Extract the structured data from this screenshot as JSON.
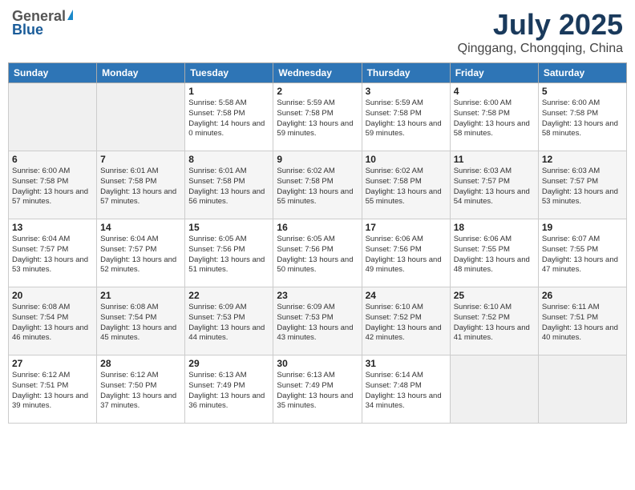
{
  "header": {
    "logo_general": "General",
    "logo_blue": "Blue",
    "title": "July 2025",
    "subtitle": "Qinggang, Chongqing, China"
  },
  "weekdays": [
    "Sunday",
    "Monday",
    "Tuesday",
    "Wednesday",
    "Thursday",
    "Friday",
    "Saturday"
  ],
  "weeks": [
    [
      {
        "day": "",
        "empty": true
      },
      {
        "day": "",
        "empty": true
      },
      {
        "day": "1",
        "sunrise": "Sunrise: 5:58 AM",
        "sunset": "Sunset: 7:58 PM",
        "daylight": "Daylight: 14 hours and 0 minutes."
      },
      {
        "day": "2",
        "sunrise": "Sunrise: 5:59 AM",
        "sunset": "Sunset: 7:58 PM",
        "daylight": "Daylight: 13 hours and 59 minutes."
      },
      {
        "day": "3",
        "sunrise": "Sunrise: 5:59 AM",
        "sunset": "Sunset: 7:58 PM",
        "daylight": "Daylight: 13 hours and 59 minutes."
      },
      {
        "day": "4",
        "sunrise": "Sunrise: 6:00 AM",
        "sunset": "Sunset: 7:58 PM",
        "daylight": "Daylight: 13 hours and 58 minutes."
      },
      {
        "day": "5",
        "sunrise": "Sunrise: 6:00 AM",
        "sunset": "Sunset: 7:58 PM",
        "daylight": "Daylight: 13 hours and 58 minutes."
      }
    ],
    [
      {
        "day": "6",
        "sunrise": "Sunrise: 6:00 AM",
        "sunset": "Sunset: 7:58 PM",
        "daylight": "Daylight: 13 hours and 57 minutes."
      },
      {
        "day": "7",
        "sunrise": "Sunrise: 6:01 AM",
        "sunset": "Sunset: 7:58 PM",
        "daylight": "Daylight: 13 hours and 57 minutes."
      },
      {
        "day": "8",
        "sunrise": "Sunrise: 6:01 AM",
        "sunset": "Sunset: 7:58 PM",
        "daylight": "Daylight: 13 hours and 56 minutes."
      },
      {
        "day": "9",
        "sunrise": "Sunrise: 6:02 AM",
        "sunset": "Sunset: 7:58 PM",
        "daylight": "Daylight: 13 hours and 55 minutes."
      },
      {
        "day": "10",
        "sunrise": "Sunrise: 6:02 AM",
        "sunset": "Sunset: 7:58 PM",
        "daylight": "Daylight: 13 hours and 55 minutes."
      },
      {
        "day": "11",
        "sunrise": "Sunrise: 6:03 AM",
        "sunset": "Sunset: 7:57 PM",
        "daylight": "Daylight: 13 hours and 54 minutes."
      },
      {
        "day": "12",
        "sunrise": "Sunrise: 6:03 AM",
        "sunset": "Sunset: 7:57 PM",
        "daylight": "Daylight: 13 hours and 53 minutes."
      }
    ],
    [
      {
        "day": "13",
        "sunrise": "Sunrise: 6:04 AM",
        "sunset": "Sunset: 7:57 PM",
        "daylight": "Daylight: 13 hours and 53 minutes."
      },
      {
        "day": "14",
        "sunrise": "Sunrise: 6:04 AM",
        "sunset": "Sunset: 7:57 PM",
        "daylight": "Daylight: 13 hours and 52 minutes."
      },
      {
        "day": "15",
        "sunrise": "Sunrise: 6:05 AM",
        "sunset": "Sunset: 7:56 PM",
        "daylight": "Daylight: 13 hours and 51 minutes."
      },
      {
        "day": "16",
        "sunrise": "Sunrise: 6:05 AM",
        "sunset": "Sunset: 7:56 PM",
        "daylight": "Daylight: 13 hours and 50 minutes."
      },
      {
        "day": "17",
        "sunrise": "Sunrise: 6:06 AM",
        "sunset": "Sunset: 7:56 PM",
        "daylight": "Daylight: 13 hours and 49 minutes."
      },
      {
        "day": "18",
        "sunrise": "Sunrise: 6:06 AM",
        "sunset": "Sunset: 7:55 PM",
        "daylight": "Daylight: 13 hours and 48 minutes."
      },
      {
        "day": "19",
        "sunrise": "Sunrise: 6:07 AM",
        "sunset": "Sunset: 7:55 PM",
        "daylight": "Daylight: 13 hours and 47 minutes."
      }
    ],
    [
      {
        "day": "20",
        "sunrise": "Sunrise: 6:08 AM",
        "sunset": "Sunset: 7:54 PM",
        "daylight": "Daylight: 13 hours and 46 minutes."
      },
      {
        "day": "21",
        "sunrise": "Sunrise: 6:08 AM",
        "sunset": "Sunset: 7:54 PM",
        "daylight": "Daylight: 13 hours and 45 minutes."
      },
      {
        "day": "22",
        "sunrise": "Sunrise: 6:09 AM",
        "sunset": "Sunset: 7:53 PM",
        "daylight": "Daylight: 13 hours and 44 minutes."
      },
      {
        "day": "23",
        "sunrise": "Sunrise: 6:09 AM",
        "sunset": "Sunset: 7:53 PM",
        "daylight": "Daylight: 13 hours and 43 minutes."
      },
      {
        "day": "24",
        "sunrise": "Sunrise: 6:10 AM",
        "sunset": "Sunset: 7:52 PM",
        "daylight": "Daylight: 13 hours and 42 minutes."
      },
      {
        "day": "25",
        "sunrise": "Sunrise: 6:10 AM",
        "sunset": "Sunset: 7:52 PM",
        "daylight": "Daylight: 13 hours and 41 minutes."
      },
      {
        "day": "26",
        "sunrise": "Sunrise: 6:11 AM",
        "sunset": "Sunset: 7:51 PM",
        "daylight": "Daylight: 13 hours and 40 minutes."
      }
    ],
    [
      {
        "day": "27",
        "sunrise": "Sunrise: 6:12 AM",
        "sunset": "Sunset: 7:51 PM",
        "daylight": "Daylight: 13 hours and 39 minutes."
      },
      {
        "day": "28",
        "sunrise": "Sunrise: 6:12 AM",
        "sunset": "Sunset: 7:50 PM",
        "daylight": "Daylight: 13 hours and 37 minutes."
      },
      {
        "day": "29",
        "sunrise": "Sunrise: 6:13 AM",
        "sunset": "Sunset: 7:49 PM",
        "daylight": "Daylight: 13 hours and 36 minutes."
      },
      {
        "day": "30",
        "sunrise": "Sunrise: 6:13 AM",
        "sunset": "Sunset: 7:49 PM",
        "daylight": "Daylight: 13 hours and 35 minutes."
      },
      {
        "day": "31",
        "sunrise": "Sunrise: 6:14 AM",
        "sunset": "Sunset: 7:48 PM",
        "daylight": "Daylight: 13 hours and 34 minutes."
      },
      {
        "day": "",
        "empty": true
      },
      {
        "day": "",
        "empty": true
      }
    ]
  ]
}
